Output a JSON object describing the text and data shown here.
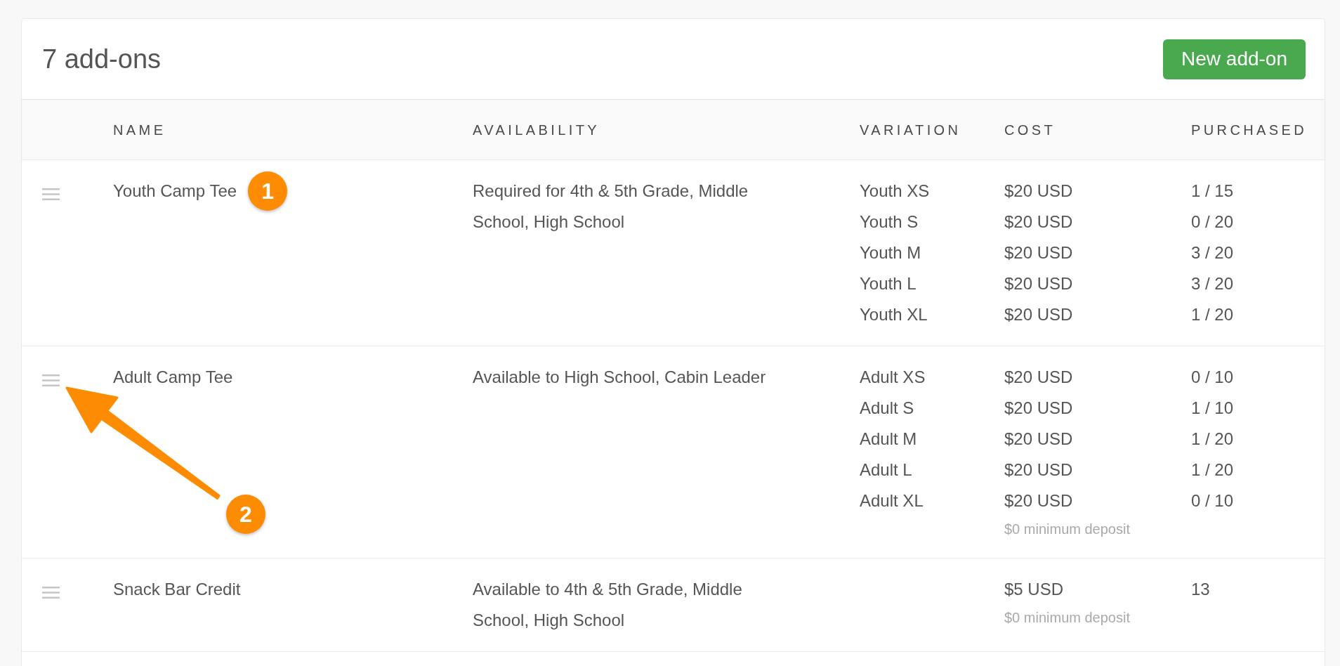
{
  "header": {
    "title": "7 add-ons",
    "button": "New add-on"
  },
  "table": {
    "columns": [
      "NAME",
      "AVAILABILITY",
      "VARIATION",
      "COST",
      "PURCHASED"
    ],
    "rows": [
      {
        "name": "Youth Camp Tee",
        "callout": {
          "kind": "badge",
          "label": "1"
        },
        "availability": "Required for 4th & 5th Grade, Middle School, High School",
        "variations": [
          {
            "name": "Youth XS",
            "cost": "$20 USD",
            "purchased": "1 / 15"
          },
          {
            "name": "Youth S",
            "cost": "$20 USD",
            "purchased": "0 / 20"
          },
          {
            "name": "Youth M",
            "cost": "$20 USD",
            "purchased": "3 / 20"
          },
          {
            "name": "Youth L",
            "cost": "$20 USD",
            "purchased": "3 / 20"
          },
          {
            "name": "Youth XL",
            "cost": "$20 USD",
            "purchased": "1 / 20"
          }
        ]
      },
      {
        "name": "Adult Camp Tee",
        "callout": {
          "kind": "arrow",
          "label": "2"
        },
        "availability": "Available to High School, Cabin Leader",
        "variations": [
          {
            "name": "Adult XS",
            "cost": "$20 USD",
            "purchased": "0 / 10"
          },
          {
            "name": "Adult S",
            "cost": "$20 USD",
            "purchased": "1 / 10"
          },
          {
            "name": "Adult M",
            "cost": "$20 USD",
            "purchased": "1 / 20"
          },
          {
            "name": "Adult L",
            "cost": "$20 USD",
            "purchased": "1 / 20"
          },
          {
            "name": "Adult XL",
            "cost": "$20 USD",
            "purchased": "0 / 10"
          }
        ],
        "deposit": "$0 minimum deposit"
      },
      {
        "name": "Snack Bar Credit",
        "availability": "Available to 4th & 5th Grade, Middle School, High School",
        "variations": [
          {
            "cost": "$5 USD",
            "purchased": "13"
          }
        ],
        "deposit": "$0 minimum deposit"
      }
    ]
  }
}
